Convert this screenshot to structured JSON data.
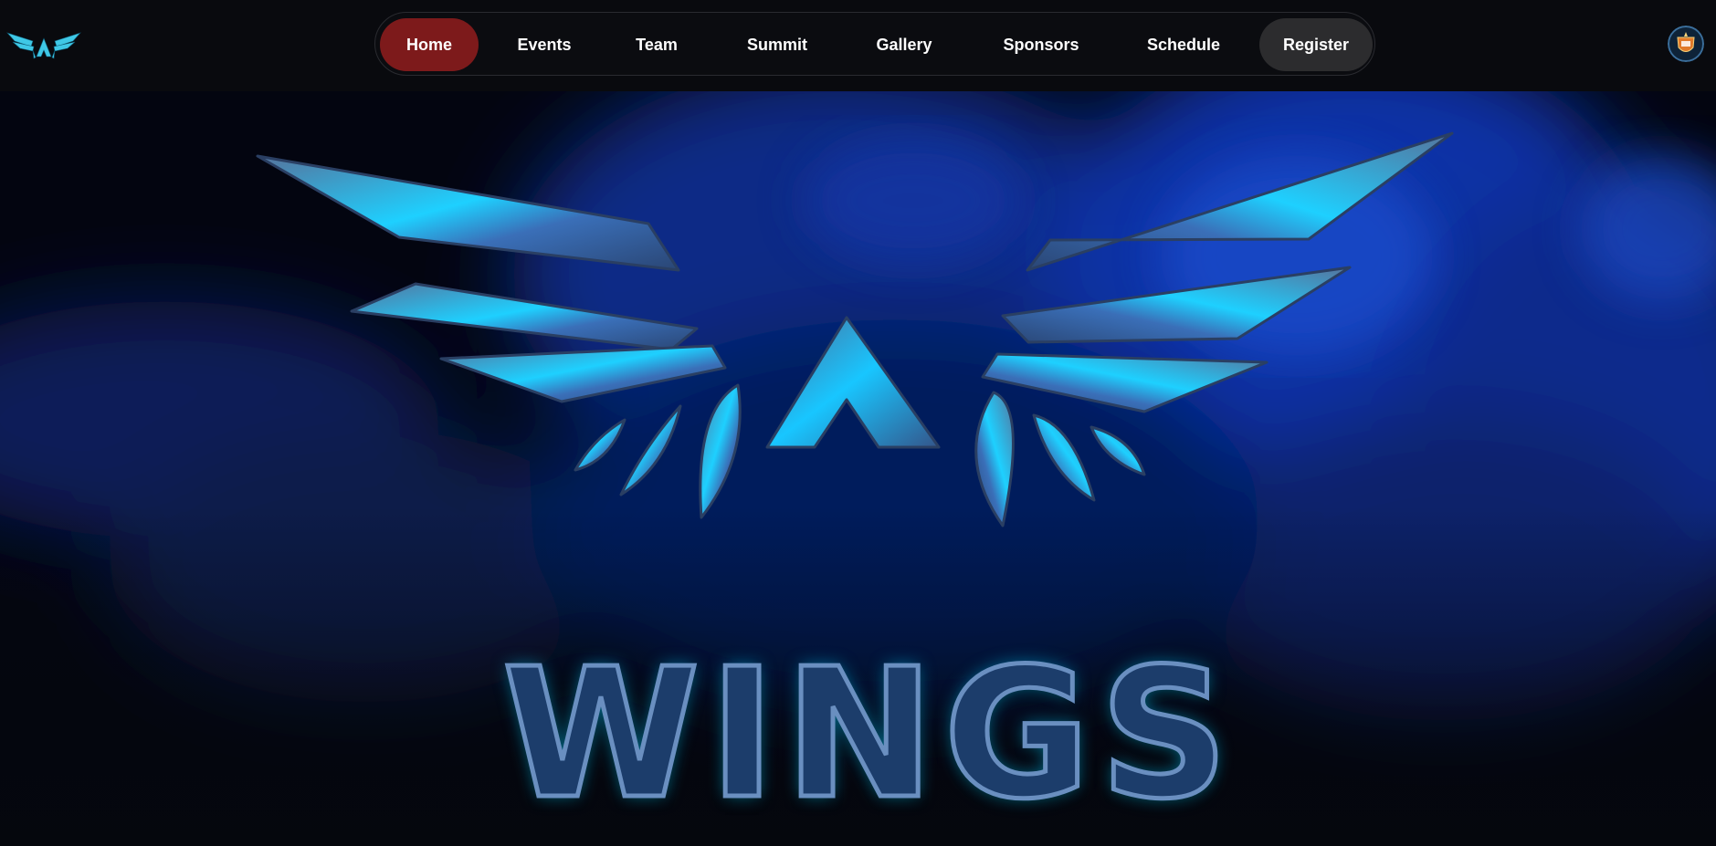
{
  "nav": {
    "items": [
      {
        "label": "Home",
        "active": true
      },
      {
        "label": "Events"
      },
      {
        "label": "Team"
      },
      {
        "label": "Summit"
      },
      {
        "label": "Gallery"
      },
      {
        "label": "Sponsors"
      },
      {
        "label": "Schedule"
      },
      {
        "label": "Register",
        "cta": true
      }
    ]
  },
  "hero": {
    "wordmark": "WINGS"
  },
  "colors": {
    "active_tab": "#7d1a1b",
    "register_button": "#2c2c2e",
    "accent_cyan": "#00d8ff",
    "hero_blue": "#0b2f8a"
  },
  "icons": {
    "site_logo": "winged-a-logo-icon",
    "profile": "college-crest-icon"
  }
}
